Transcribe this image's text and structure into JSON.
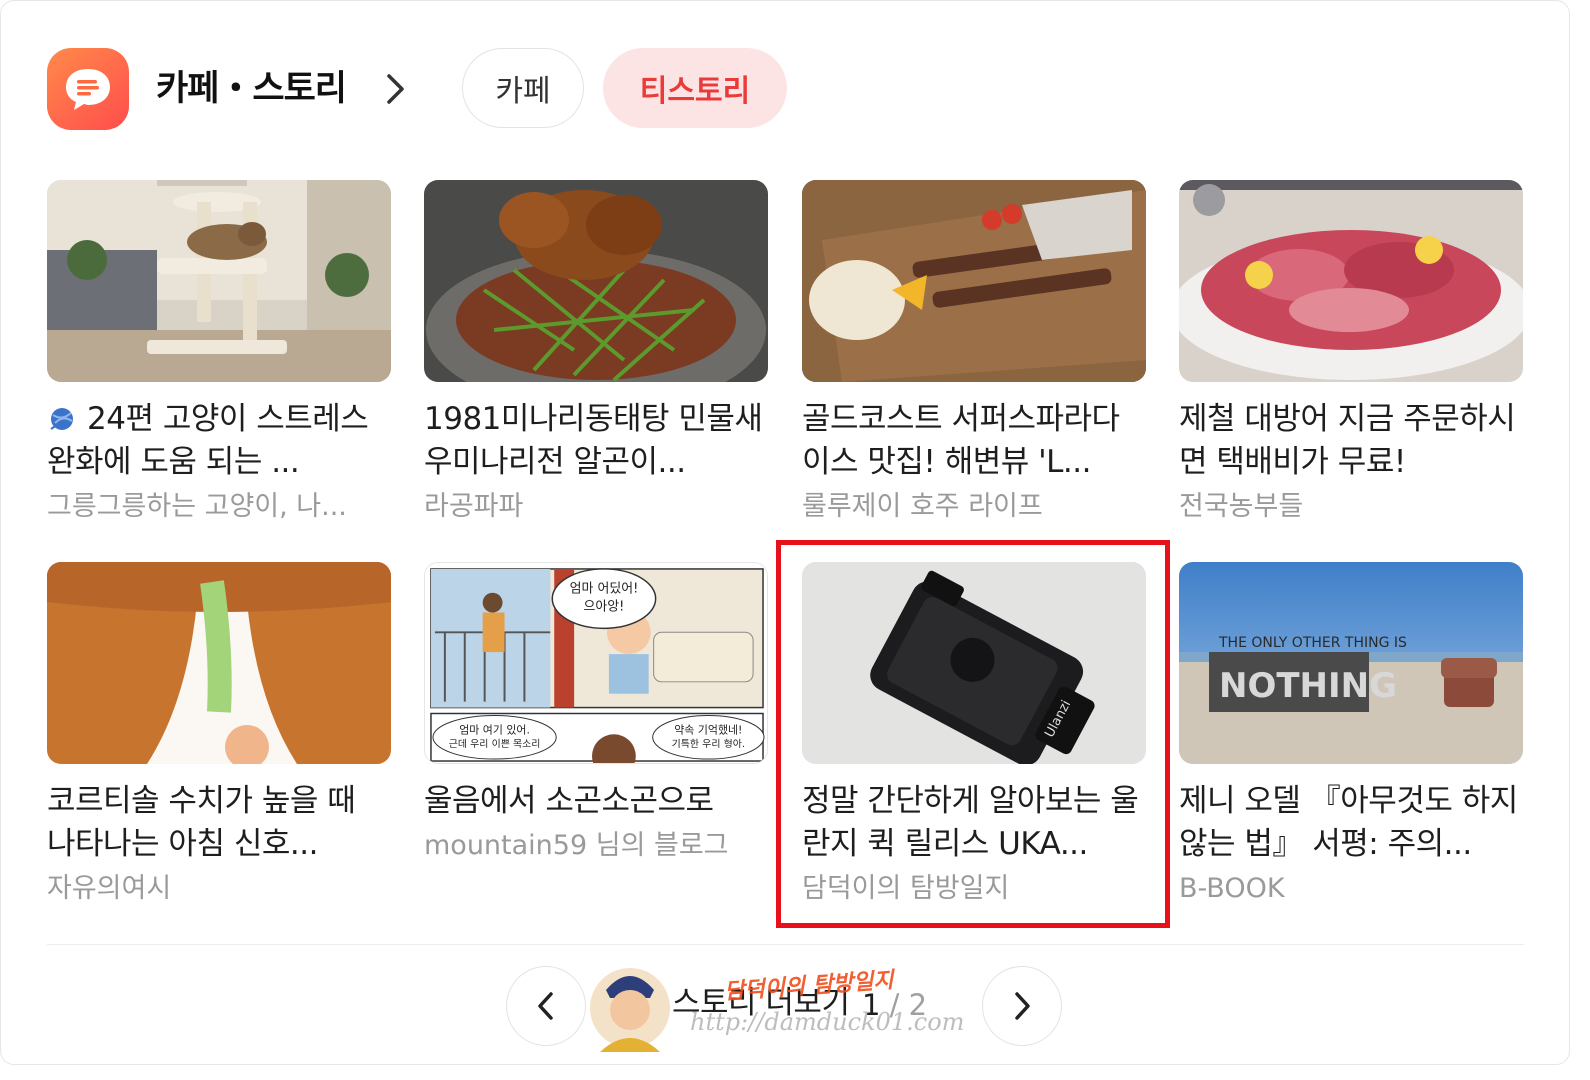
{
  "header": {
    "title": "카페・스토리",
    "tabs": [
      {
        "label": "카페",
        "active": false
      },
      {
        "label": "티스토리",
        "active": true
      }
    ]
  },
  "cards": [
    {
      "title": "24편 고양이 스트레스 완화에 도움 되는 ...",
      "source": "그릉그릉하는 고양이, 나...",
      "icon": "yarn-ball-icon",
      "thumb": "cat-tower-photo"
    },
    {
      "title": "1981미나리동태탕 민물새우미나리전 알곤이...",
      "source": "라공파파",
      "thumb": "fried-fish-salad-photo"
    },
    {
      "title": "골드코스트 서퍼스파라다이스 맛집! 해변뷰 'L...",
      "source": "룰루제이 호주 라이프",
      "thumb": "skewers-rice-photo"
    },
    {
      "title": "제철 대방어 지금 주문하시면 택배비가 무료!",
      "source": "전국농부들",
      "thumb": "sashimi-platter-photo"
    },
    {
      "title": "코르티솔 수치가 높을 때 나타나는 아침 신호...",
      "source": "자유의여시",
      "thumb": "illustration-legs"
    },
    {
      "title": "울음에서 소곤소곤으로",
      "source": "mountain59",
      "source_suffix": " 님의 블로그",
      "thumb": "comic-strip",
      "comic_text": [
        "엄마 어딨어!",
        "으아앙!",
        "엄마 여기 있어.",
        "근데 우리 이쁜 목소리",
        "약속 기억했네!",
        "기특한 우리 형아."
      ]
    },
    {
      "title": "정말 간단하게 알아보는 울란지 퀵 릴리스 UKA...",
      "source": "담덕이의 탐방일지",
      "thumb": "quick-release-plate-photo",
      "brand_text": "Ulanzi",
      "highlighted": true
    },
    {
      "title": "제니 오델 『아무것도 하지 않는 법』 서평: 주의...",
      "source": "B-BOOK",
      "thumb": "nothing-sign-photo",
      "sign_text": [
        "THE ONLY OTHER THING IS",
        "NOTHING"
      ]
    }
  ],
  "footer": {
    "more_label": "스토리 더보기",
    "page_current": "1",
    "page_total": "/ 2"
  },
  "watermark": {
    "name": "담덕이의 탐방일지",
    "url": "http://damduck01.com"
  },
  "colors": {
    "accent_red": "#ea3b3b",
    "tab_active_bg": "#fde4e4",
    "highlight_border": "#e8101b",
    "source_gray": "#9a9a9a"
  }
}
